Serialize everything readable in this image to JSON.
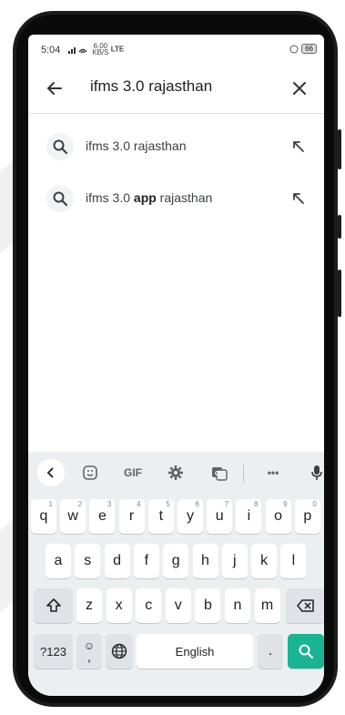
{
  "status": {
    "time": "5:04",
    "network_speed": "6.00",
    "network_unit": "KB/S",
    "network_type": "LTE",
    "battery": "66"
  },
  "search": {
    "query": "ifms 3.0 rajasthan"
  },
  "suggestions": [
    {
      "prefix": "ifms 3.0 ",
      "bold": "",
      "suffix": "rajasthan"
    },
    {
      "prefix": "ifms 3.0 ",
      "bold": "app",
      "suffix": " rajasthan"
    }
  ],
  "keyboard": {
    "toolbar": {
      "gif": "GIF",
      "more": "•••"
    },
    "row1": [
      {
        "k": "q",
        "h": "1"
      },
      {
        "k": "w",
        "h": "2"
      },
      {
        "k": "e",
        "h": "3"
      },
      {
        "k": "r",
        "h": "4"
      },
      {
        "k": "t",
        "h": "5"
      },
      {
        "k": "y",
        "h": "6"
      },
      {
        "k": "u",
        "h": "7"
      },
      {
        "k": "i",
        "h": "8"
      },
      {
        "k": "o",
        "h": "9"
      },
      {
        "k": "p",
        "h": "0"
      }
    ],
    "row2": [
      "a",
      "s",
      "d",
      "f",
      "g",
      "h",
      "j",
      "k",
      "l"
    ],
    "row3": [
      "z",
      "x",
      "c",
      "v",
      "b",
      "n",
      "m"
    ],
    "symbols_label": "?123",
    "emoji_label": "☺",
    "comma_label": ",",
    "space_label": "English",
    "period_label": ".",
    "accent_color": "#1ab394"
  }
}
